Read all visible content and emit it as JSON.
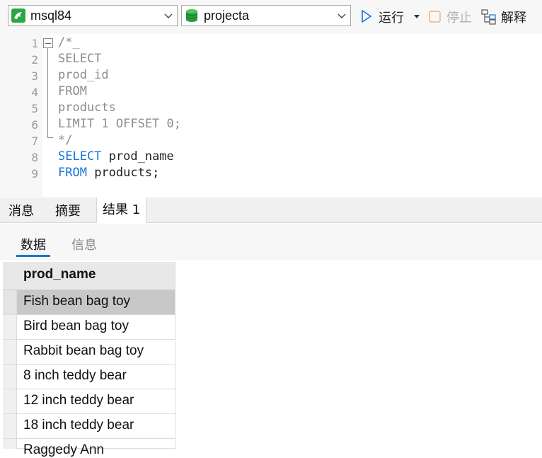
{
  "toolbar": {
    "connection": "msql84",
    "database": "projecta",
    "run_label": "运行",
    "stop_label": "停止",
    "explain_label": "解释"
  },
  "editor": {
    "line_numbers": [
      "1",
      "2",
      "3",
      "4",
      "5",
      "6",
      "7",
      "8",
      "9"
    ],
    "lines": [
      {
        "text": "/*_",
        "kind": "comment"
      },
      {
        "text": "SELECT",
        "kind": "comment"
      },
      {
        "text": "prod_id",
        "kind": "comment"
      },
      {
        "text": "FROM",
        "kind": "comment"
      },
      {
        "text": "products",
        "kind": "comment"
      },
      {
        "text": "LIMIT 1 OFFSET 0;",
        "kind": "comment"
      },
      {
        "text": "*/",
        "kind": "comment"
      },
      {
        "kw": "SELECT",
        "rest": " prod_name",
        "kind": "code"
      },
      {
        "kw": "FROM",
        "rest": " products;",
        "kind": "code"
      }
    ]
  },
  "result_tabs": [
    "消息",
    "摘要",
    "结果 1"
  ],
  "sub_tabs": [
    "数据",
    "信息"
  ],
  "grid": {
    "column": "prod_name",
    "rows": [
      "Fish bean bag toy",
      "Bird bean bag toy",
      "Rabbit bean bag toy",
      "8 inch teddy bear",
      "12 inch teddy bear",
      "18 inch teddy bear",
      "Raggedy Ann"
    ]
  },
  "colors": {
    "keyword": "#1a73d6",
    "comment": "#8c8c8c",
    "accent": "#1a73d6"
  }
}
